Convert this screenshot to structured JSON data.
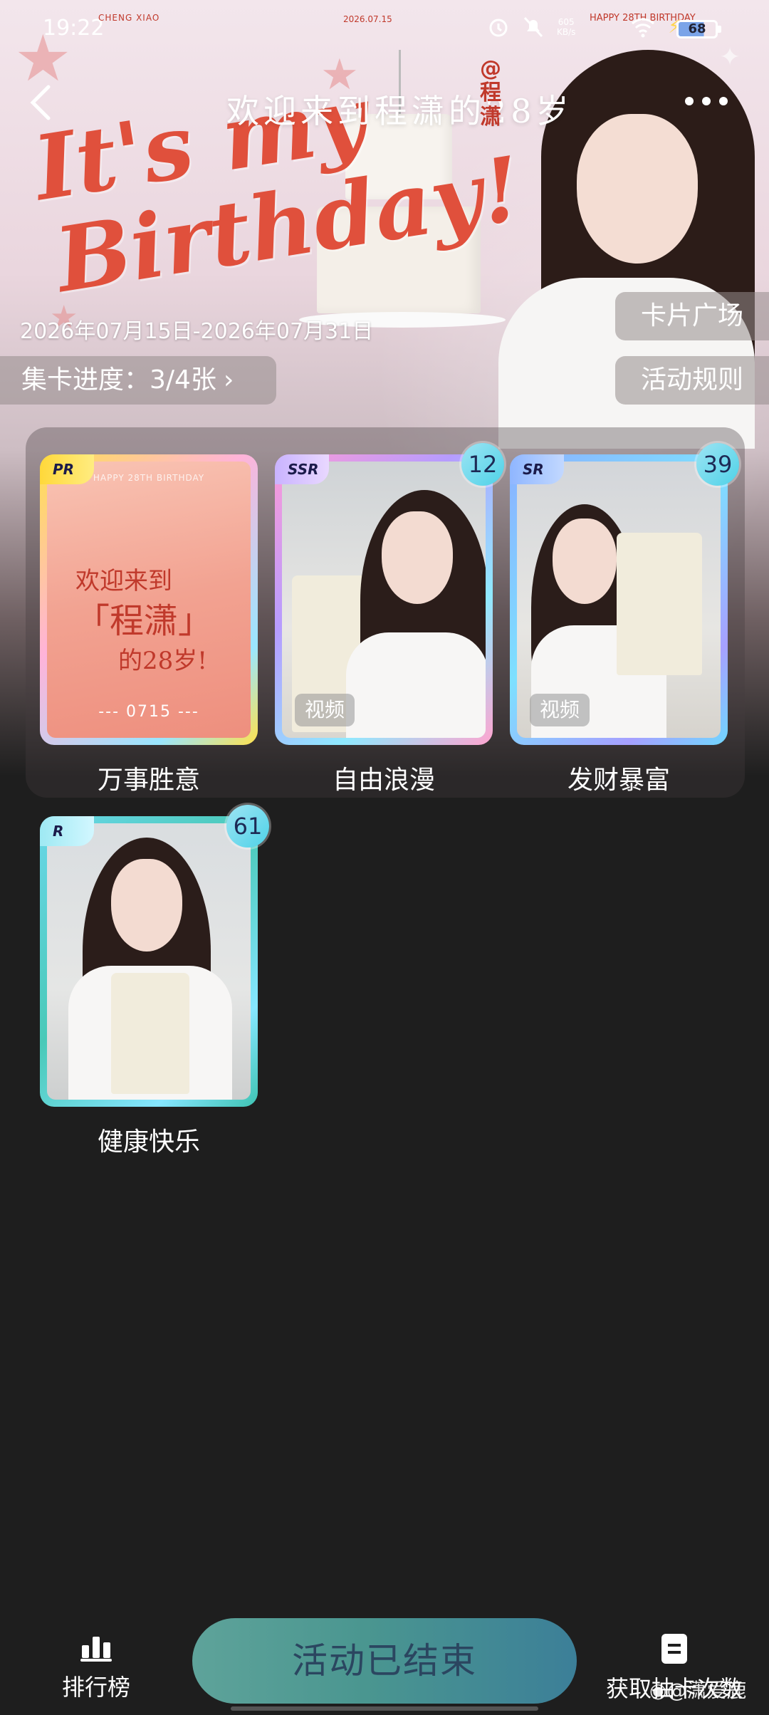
{
  "status_bar": {
    "time": "19:22",
    "deco_left": "CHENG XIAO",
    "date_deco": "2026.07.15",
    "deco_right": "HAPPY 28TH BIRTHDAY",
    "net_speed": "605",
    "net_unit": "KB/s",
    "battery": "68"
  },
  "header": {
    "title": "欢迎来到程潇的28岁",
    "weibo_tag": "@程潇",
    "art_line1": "It's my",
    "art_line2": "Birthday!"
  },
  "event": {
    "date_range": "2026年07月15日-2026年07月31日",
    "progress": "集卡进度：3/4张",
    "progress_arrow": "›",
    "card_plaza": "卡片广场",
    "rules": "活动规则"
  },
  "cards": [
    {
      "rarity": "PR",
      "name": "万事胜意",
      "count": "",
      "video": "",
      "art_top": "HAPPY 28TH BIRTHDAY",
      "art_line1": "欢迎来到",
      "art_line2": "「程潇」",
      "art_line3": "的28岁!",
      "art_code": "--- 0715 ---"
    },
    {
      "rarity": "SSR",
      "name": "自由浪漫",
      "count": "12",
      "video": "视频"
    },
    {
      "rarity": "SR",
      "name": "发财暴富",
      "count": "39",
      "video": "视频"
    },
    {
      "rarity": "R",
      "name": "健康快乐",
      "count": "61",
      "video": ""
    }
  ],
  "bottom": {
    "rank_label": "排行榜",
    "end_button": "活动已结束",
    "draws_label": "获取抽卡次数"
  },
  "watermark": "@潇爱鹿",
  "colors": {
    "art_red": "#e0503c",
    "page_bg": "#1e1e1e",
    "button_teal": "#4a9690"
  }
}
